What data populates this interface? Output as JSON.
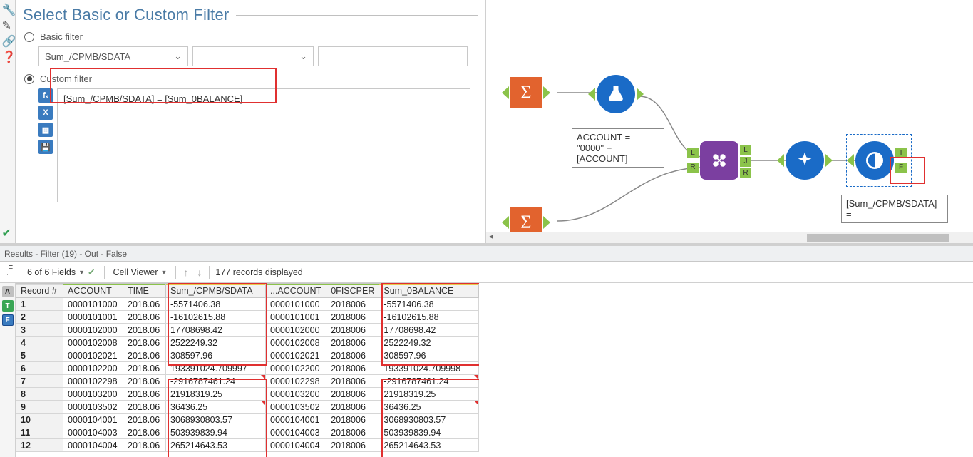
{
  "panel": {
    "title": "Select Basic or Custom Filter",
    "basic_label": "Basic filter",
    "custom_label": "Custom filter",
    "basic_field": "Sum_/CPMB/SDATA",
    "basic_op": "=",
    "custom_expr": "[Sum_/CPMB/SDATA] = [Sum_0BALANCE]"
  },
  "canvas": {
    "anno_account": "ACCOUNT = \"0000\" + [ACCOUNT]",
    "anno_filter": "[Sum_/CPMB/SDATA] ="
  },
  "status": "Results - Filter (19) - Out - False",
  "toolbar": {
    "fields": "6 of 6 Fields",
    "cell_viewer": "Cell Viewer",
    "records": "177 records displayed"
  },
  "columns": [
    "Record #",
    "ACCOUNT",
    "TIME",
    "Sum_/CPMB/SDATA",
    "...ACCOUNT",
    "0FISCPER",
    "Sum_0BALANCE"
  ],
  "rows": [
    {
      "n": "1",
      "acct": "0000101000",
      "time": "2018.06",
      "sdata": "-5571406.38",
      "acct2": "0000101000",
      "fisc": "2018006",
      "bal": "-5571406.38"
    },
    {
      "n": "2",
      "acct": "0000101001",
      "time": "2018.06",
      "sdata": "-16102615.88",
      "acct2": "0000101001",
      "fisc": "2018006",
      "bal": "-16102615.88"
    },
    {
      "n": "3",
      "acct": "0000102000",
      "time": "2018.06",
      "sdata": "17708698.42",
      "acct2": "0000102000",
      "fisc": "2018006",
      "bal": "17708698.42"
    },
    {
      "n": "4",
      "acct": "0000102008",
      "time": "2018.06",
      "sdata": "2522249.32",
      "acct2": "0000102008",
      "fisc": "2018006",
      "bal": "2522249.32"
    },
    {
      "n": "5",
      "acct": "0000102021",
      "time": "2018.06",
      "sdata": "308597.96",
      "acct2": "0000102021",
      "fisc": "2018006",
      "bal": "308597.96"
    },
    {
      "n": "6",
      "acct": "0000102200",
      "time": "2018.06",
      "sdata": "193391024.709997",
      "acct2": "0000102200",
      "fisc": "2018006",
      "bal": "193391024.709998"
    },
    {
      "n": "7",
      "acct": "0000102298",
      "time": "2018.06",
      "sdata": "-2916787461.24",
      "acct2": "0000102298",
      "fisc": "2018006",
      "bal": "-2916787461.24"
    },
    {
      "n": "8",
      "acct": "0000103200",
      "time": "2018.06",
      "sdata": "21918319.25",
      "acct2": "0000103200",
      "fisc": "2018006",
      "bal": "21918319.25"
    },
    {
      "n": "9",
      "acct": "0000103502",
      "time": "2018.06",
      "sdata": "36436.25",
      "acct2": "0000103502",
      "fisc": "2018006",
      "bal": "36436.25"
    },
    {
      "n": "10",
      "acct": "0000104001",
      "time": "2018.06",
      "sdata": "3068930803.57",
      "acct2": "0000104001",
      "fisc": "2018006",
      "bal": "3068930803.57"
    },
    {
      "n": "11",
      "acct": "0000104003",
      "time": "2018.06",
      "sdata": "503939839.94",
      "acct2": "0000104003",
      "fisc": "2018006",
      "bal": "503939839.94"
    },
    {
      "n": "12",
      "acct": "0000104004",
      "time": "2018.06",
      "sdata": "265214643.53",
      "acct2": "0000104004",
      "fisc": "2018006",
      "bal": "265214643.53"
    }
  ]
}
